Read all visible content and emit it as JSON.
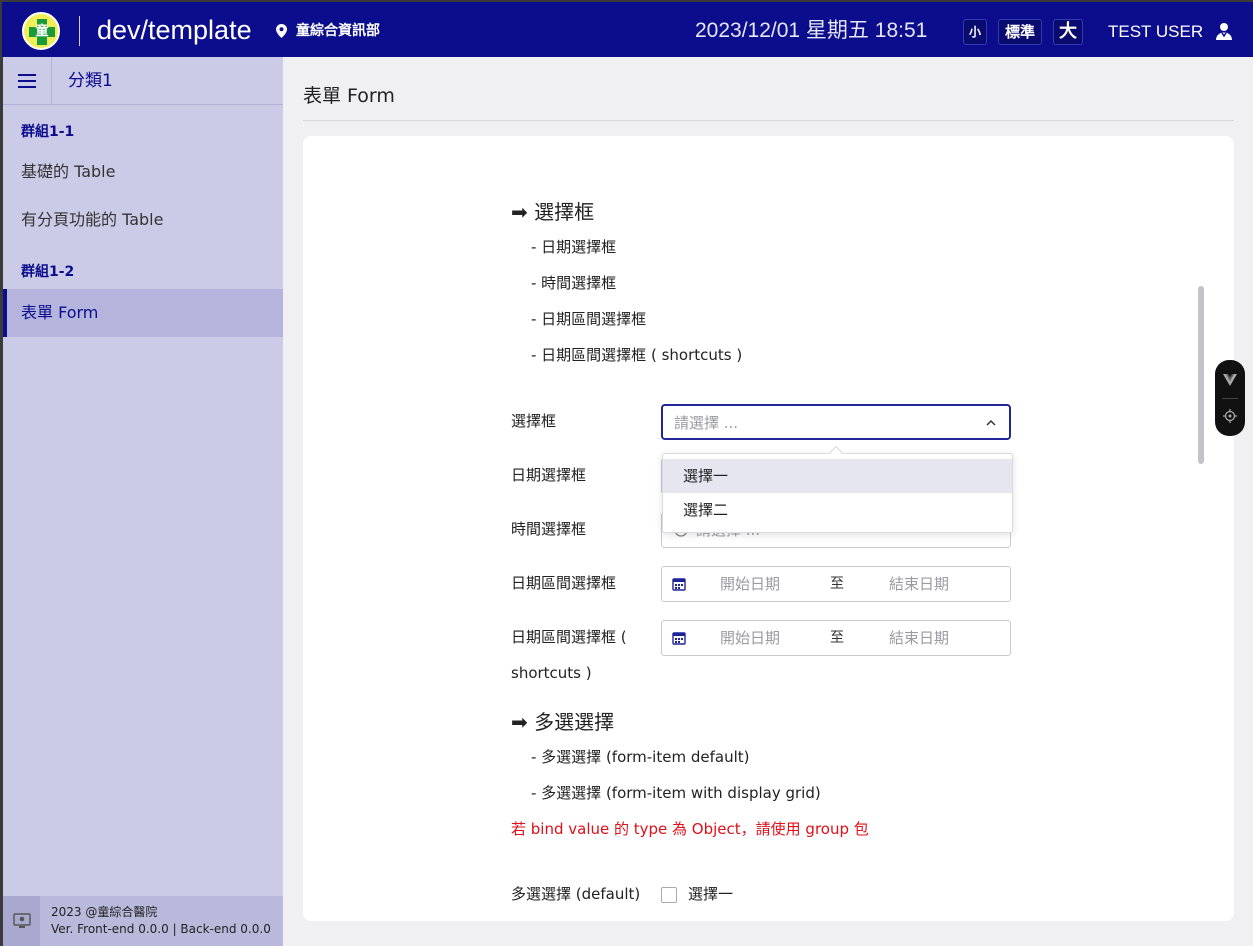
{
  "header": {
    "app_title": "dev/template",
    "location": "童綜合資訊部",
    "datetime": "2023/12/01 星期五 18:51",
    "font_size_small": "小",
    "font_size_normal": "標準",
    "font_size_large": "大",
    "user_name": "TEST USER",
    "icons": [
      "hospital-logo-icon",
      "location-pin-icon",
      "user-icon"
    ]
  },
  "sidebar": {
    "category": "分類1",
    "groups": [
      {
        "label": "群組1-1",
        "items": [
          {
            "label": "基礎的 Table"
          },
          {
            "label": "有分頁功能的 Table"
          }
        ]
      },
      {
        "label": "群組1-2",
        "items": [
          {
            "label": "表單 Form",
            "active": true
          }
        ]
      }
    ],
    "footer": {
      "line1": "2023 @童綜合醫院",
      "line2": "Ver. Front-end 0.0.0 | Back-end 0.0.0"
    }
  },
  "main": {
    "page_title": "表單 Form",
    "select_section": {
      "heading": "➡ 選擇框",
      "bullets": [
        "- 日期選擇框",
        "- 時間選擇框",
        "- 日期區間選擇框",
        "- 日期區間選擇框 ( shortcuts )"
      ]
    },
    "form": {
      "select_label": "選擇框",
      "select_placeholder": "請選擇 ...",
      "date_label": "日期選擇框",
      "time_label": "時間選擇框",
      "time_placeholder": "請選擇 ...",
      "daterange_label": "日期區間選擇框",
      "daterange_shortcuts_label_1": "日期區間選擇框 (",
      "daterange_shortcuts_label_2": "shortcuts )",
      "range_start": "開始日期",
      "range_sep": "至",
      "range_end": "結束日期"
    },
    "dropdown": {
      "options": [
        "選擇一",
        "選擇二"
      ],
      "hovered": "選擇一"
    },
    "multi_section": {
      "heading": "➡ 多選選擇",
      "bullets": [
        "- 多選選擇 (form-item default)",
        "- 多選選擇 (form-item with display grid)"
      ],
      "warning": "若 bind value 的 type 為 Object，請使用 group 包",
      "checkbox_label": "多選選擇 (default)",
      "checkbox_option": "選擇一"
    }
  },
  "colors": {
    "brand": "#0b0d8c",
    "sidebar_bg": "#cbcbe8",
    "warning": "#e0101a"
  }
}
